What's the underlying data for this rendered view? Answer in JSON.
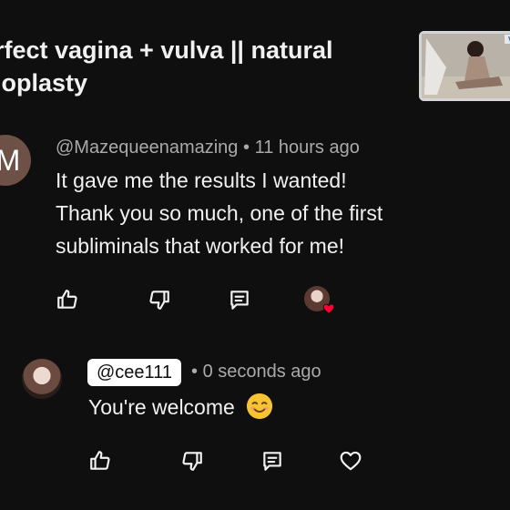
{
  "video": {
    "title_line1": "rfect vagina + vulva || natural",
    "title_line2": "ioplasty"
  },
  "comment": {
    "avatar_letter": "M",
    "author": "@Mazequeenamazing",
    "separator": "•",
    "time": "11 hours ago",
    "text_lines": [
      "It gave me the results I wanted!",
      "Thank you so much, one of the first",
      "subliminals that worked for me!"
    ]
  },
  "reply": {
    "mention": "@cee111",
    "separator": "•",
    "time": "0 seconds ago",
    "text": "You're welcome"
  },
  "icons": {
    "like": "thumbs-up-icon",
    "dislike": "thumbs-down-icon",
    "reply": "comment-icon",
    "heart": "heart-icon",
    "smile": "smiling-face-emoji"
  },
  "colors": {
    "background": "#0f0f0f",
    "text_primary": "#f1f1f1",
    "text_secondary": "#aaaaaa",
    "heart_red": "#ff0033"
  }
}
